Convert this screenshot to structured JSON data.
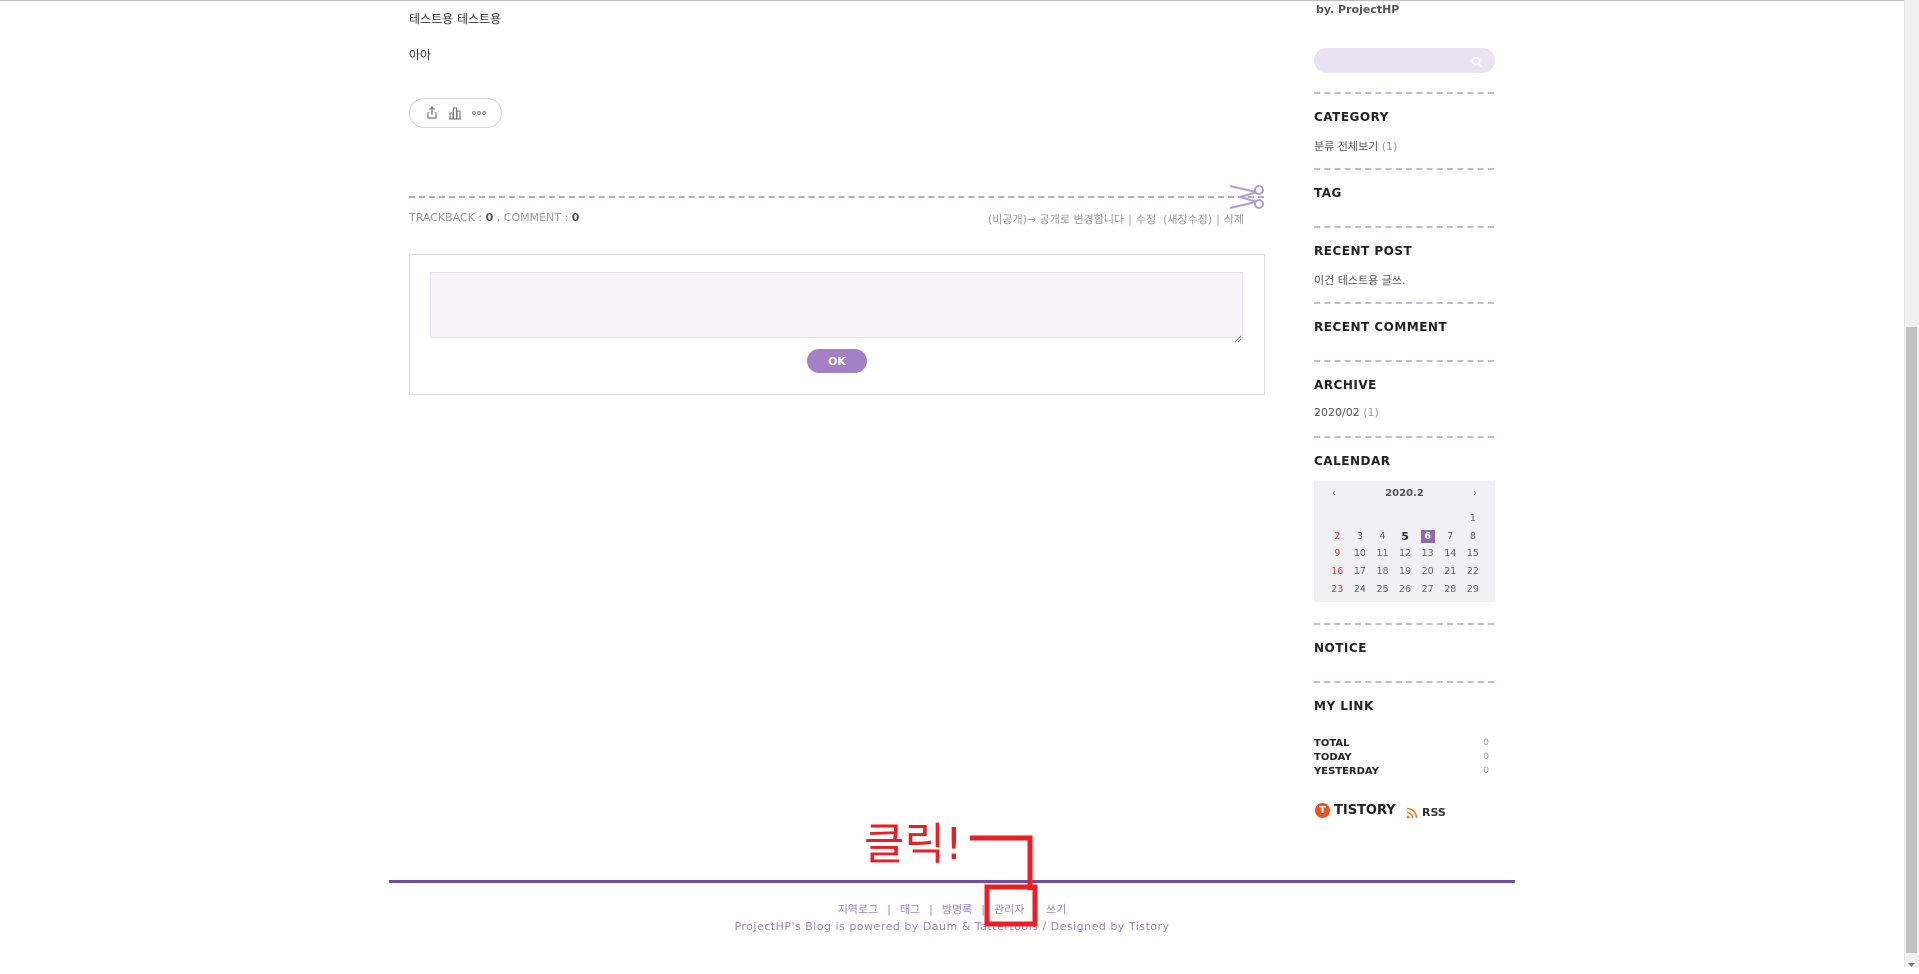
{
  "post": {
    "line1": "테스트용 테스트용",
    "line2": "아아"
  },
  "share_icons": [
    "share-icon",
    "stats-icon",
    "more-icon"
  ],
  "trackback": {
    "label1": "TRACKBACK : ",
    "count1": "0",
    "label2": " , COMMENT : ",
    "count2": "0"
  },
  "post_actions": {
    "visibility": "(비공개)→ 공개로 변경합니다",
    "edit": "수정",
    "edit_new": "(새창수정)",
    "delete": "삭제"
  },
  "comment_form": {
    "submit_label": "OK"
  },
  "sidebar": {
    "byline": "by. ProjectHP",
    "category_title": "CATEGORY",
    "category_item": "분류 전체보기",
    "category_count": "(1)",
    "tag_title": "TAG",
    "recent_post_title": "RECENT POST",
    "recent_post_item": "이건 테스트용 글쓰.",
    "recent_comment_title": "RECENT COMMENT",
    "archive_title": "ARCHIVE",
    "archive_item": "2020/02",
    "archive_count": "(1)",
    "calendar_title": "CALENDAR",
    "notice_title": "NOTICE",
    "mylink_title": "MY LINK",
    "stats": [
      {
        "label": "TOTAL",
        "value": "0"
      },
      {
        "label": "TODAY",
        "value": "0"
      },
      {
        "label": "YESTERDAY",
        "value": "0"
      }
    ],
    "tistory_label": "TISTORY",
    "rss_label": "RSS"
  },
  "calendar": {
    "prev": "‹",
    "next": "›",
    "month": "2020.2",
    "cells": [
      "",
      "",
      "",
      "",
      "",
      "",
      "1",
      "2",
      "3",
      "4",
      "5",
      "6",
      "7",
      "8",
      "9",
      "10",
      "11",
      "12",
      "13",
      "14",
      "15",
      "16",
      "17",
      "18",
      "19",
      "20",
      "21",
      "22",
      "23",
      "24",
      "25",
      "26",
      "27",
      "28",
      "29"
    ]
  },
  "footer": {
    "links": [
      "지역로그",
      "태그",
      "방명록",
      "관리자",
      "쓰기"
    ],
    "credit": "ProjectHP's Blog is powered by Daum & Tattertools / Designed by Tistory"
  },
  "annotation": {
    "text": "클릭!"
  },
  "colors": {
    "accent": "#a282c4",
    "footer_line": "#6f4ea1",
    "annotation": "#ee1d23",
    "sunday": "#e23a3a"
  }
}
